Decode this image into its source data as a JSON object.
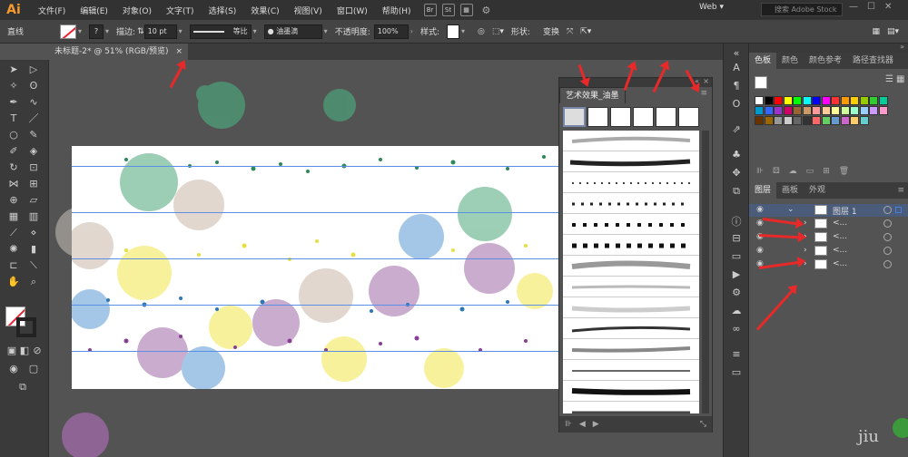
{
  "app": {
    "logo": "Ai"
  },
  "menu": [
    "文件(F)",
    "编辑(E)",
    "对象(O)",
    "文字(T)",
    "选择(S)",
    "效果(C)",
    "视图(V)",
    "窗口(W)",
    "帮助(H)"
  ],
  "bridge_btns": [
    "Br",
    "St"
  ],
  "workspace": "Web",
  "search_placeholder": "搜索 Adobe Stock",
  "control": {
    "object_type": "直线",
    "stroke_label": "描边:",
    "stroke_value": "10 pt",
    "profile": "等比",
    "brush": "油墨滴",
    "opacity_label": "不透明度:",
    "opacity_value": "100%",
    "style_label": "样式:",
    "shape_label": "形状:",
    "transform_label": "变换"
  },
  "document_tab": {
    "title": "未标题-2* @ 51% (RGB/预览)",
    "close": "×"
  },
  "brush_panel": {
    "title": "艺术效果_油墨",
    "menu_icon": "≡",
    "close": "×",
    "collapse": "«"
  },
  "right_panel": {
    "tabs_top": [
      "色板",
      "颜色",
      "颜色参考",
      "路径查找器"
    ],
    "tabs_bottom": [
      "图层",
      "画板",
      "外观"
    ],
    "layers": [
      {
        "name": "图层 1",
        "selected": true
      },
      {
        "name": "<...",
        "selected": false
      },
      {
        "name": "<...",
        "selected": false
      },
      {
        "name": "<...",
        "selected": false
      },
      {
        "name": "<...",
        "selected": false
      }
    ]
  },
  "colors": {
    "swatches": [
      "#ffffff",
      "#000000",
      "#ff0000",
      "#ffff00",
      "#00ff00",
      "#00ffff",
      "#0000ff",
      "#ff00ff",
      "#ff3333",
      "#ff9900",
      "#ffcc00",
      "#99cc00",
      "#33cc33",
      "#00cc99",
      "#0099cc",
      "#3366ff",
      "#9933cc",
      "#cc0066",
      "#996633",
      "#cc9966",
      "#ff9999",
      "#ffcc99",
      "#ffff99",
      "#ccff99",
      "#99ffcc",
      "#99ccff",
      "#cc99ff",
      "#ff99cc",
      "#663300",
      "#996600",
      "#999999",
      "#cccccc",
      "#666666",
      "#333333",
      "#ff6666",
      "#66cc66",
      "#6699cc",
      "#cc66cc",
      "#ffcc66",
      "#66cccc"
    ],
    "accent": "#4b5b7a",
    "arrow": "#e82929"
  },
  "watermark": "jiu"
}
